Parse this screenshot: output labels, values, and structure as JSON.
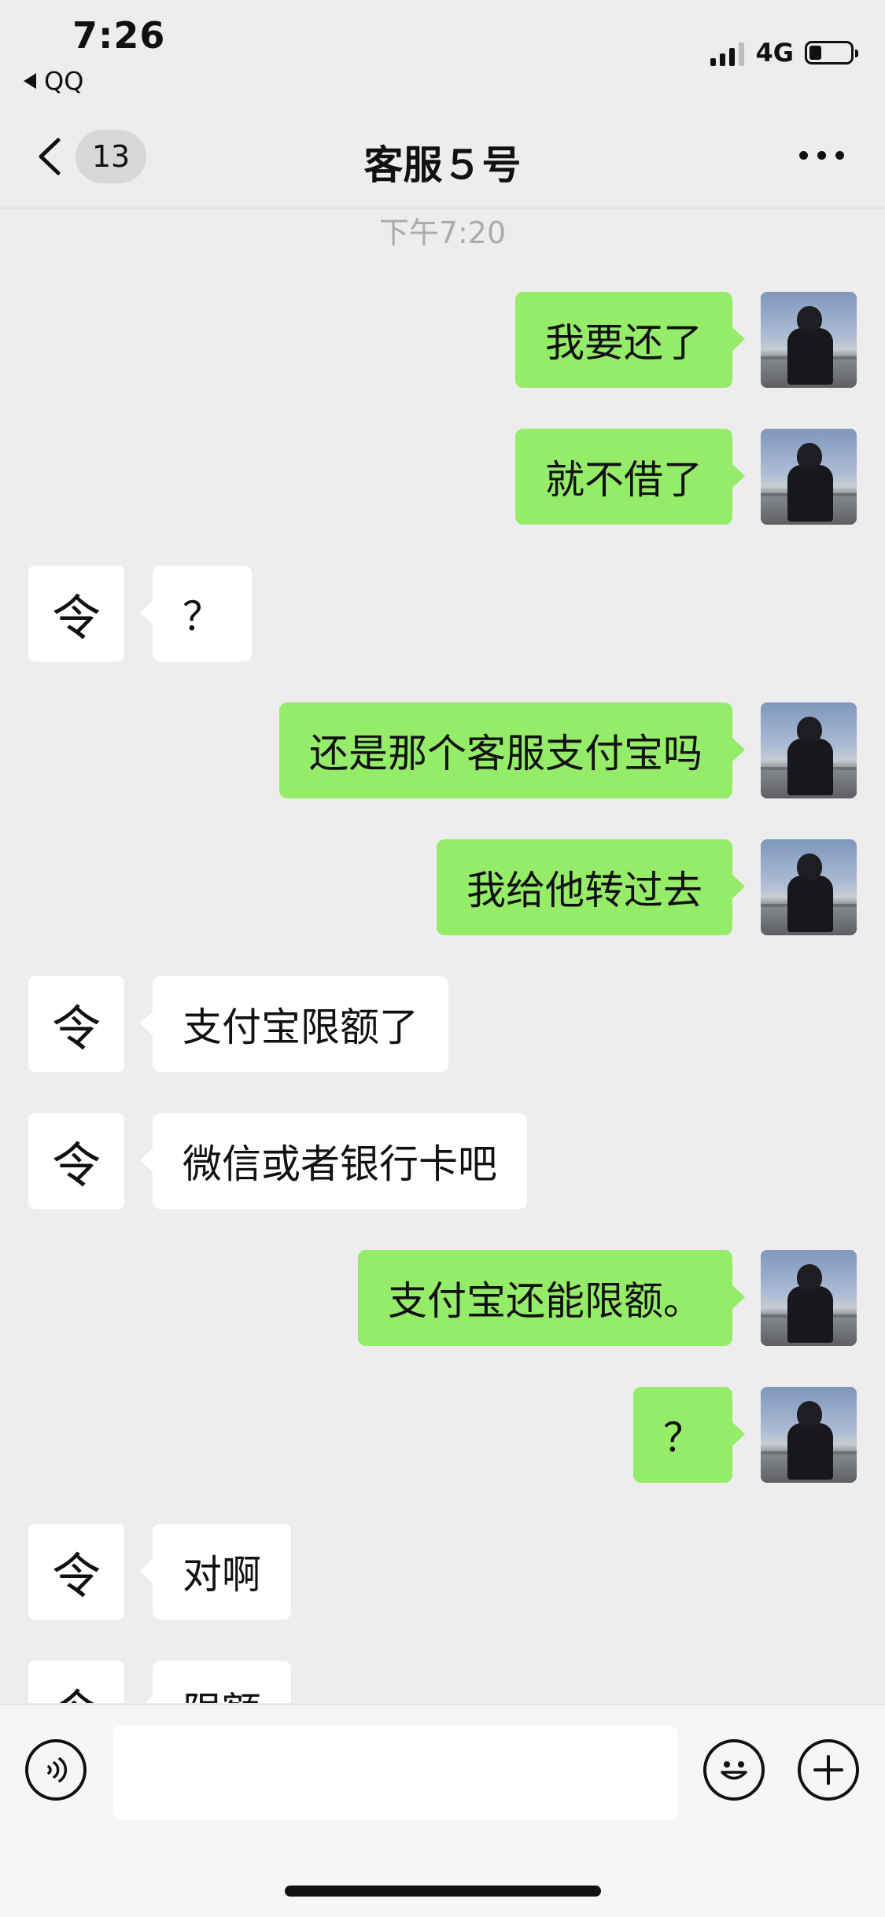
{
  "status_bar": {
    "time": "7:26",
    "back_app": "QQ",
    "network": "4G",
    "battery_percent": 20
  },
  "nav": {
    "unread_count": "13",
    "title": "客服５号"
  },
  "chat": {
    "timestamp": "下午7:20",
    "messages": [
      {
        "side": "right",
        "text": "我要还了"
      },
      {
        "side": "right",
        "text": "就不借了"
      },
      {
        "side": "left",
        "text": "？"
      },
      {
        "side": "right",
        "text": "还是那个客服支付宝吗"
      },
      {
        "side": "right",
        "text": "我给他转过去"
      },
      {
        "side": "left",
        "text": "支付宝限额了"
      },
      {
        "side": "left",
        "text": "微信或者银行卡吧"
      },
      {
        "side": "right",
        "text": "支付宝还能限额。"
      },
      {
        "side": "right",
        "text": "？"
      },
      {
        "side": "left",
        "text": "对啊"
      },
      {
        "side": "left",
        "text": "限额"
      }
    ],
    "contact_avatar_char": "令"
  },
  "input": {
    "placeholder": ""
  },
  "colors": {
    "sent_bubble": "#95ec69",
    "received_bubble": "#ffffff",
    "background": "#ededed"
  }
}
